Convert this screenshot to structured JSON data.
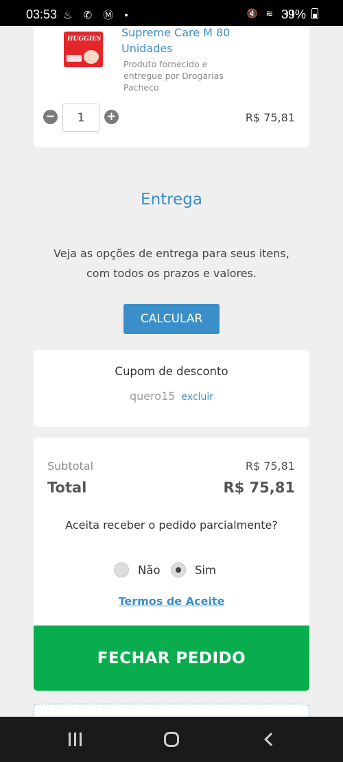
{
  "status_bar": {
    "time": "03:53",
    "notification_icons": "♨ ✆ Ⓜ •",
    "system_icons": "🔇 ≋ .ıl",
    "battery": "39%"
  },
  "product": {
    "brand": "HUGGIES",
    "name": "Supreme Care M 80 Unidades",
    "seller": "Produto fornecido e entregue por Drogarias Pacheco",
    "quantity": "1",
    "minus_symbol": "−",
    "plus_symbol": "+",
    "price": "R$ 75,81"
  },
  "delivery": {
    "title": "Entrega",
    "description_line1": "Veja as opções de entrega para seus itens,",
    "description_line2": "com todos os prazos e valores.",
    "button_label": "CALCULAR"
  },
  "coupon": {
    "title": "Cupom de desconto",
    "code": "quero15",
    "remove_label": "excluir"
  },
  "summary": {
    "subtotal_label": "Subtotal",
    "subtotal_value": "R$ 75,81",
    "total_label": "Total",
    "total_value": "R$ 75,81",
    "partial_question": "Aceita receber o pedido parcialmente?",
    "options": [
      {
        "label": "Não",
        "selected": false
      },
      {
        "label": "Sim",
        "selected": true
      }
    ],
    "terms_link": "Termos de Aceite"
  },
  "checkout": {
    "button_label": "FECHAR PEDIDO",
    "color": "#0aad4d"
  },
  "colors": {
    "accent": "#3a8fc8",
    "background": "#efefef"
  }
}
